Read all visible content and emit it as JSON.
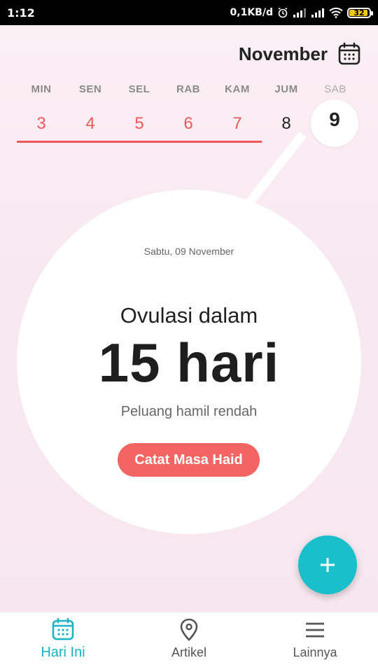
{
  "status_bar": {
    "time": "1:12",
    "network_speed": "0,1KB/d",
    "battery_level": "32",
    "icons": [
      "alarm-icon",
      "signal-icon",
      "signal-icon",
      "wifi-icon",
      "battery-icon"
    ]
  },
  "header": {
    "month": "November",
    "calendar_icon": "calendar-icon"
  },
  "week": {
    "days": [
      {
        "dow": "MIN",
        "num": "3",
        "state": "period"
      },
      {
        "dow": "SEN",
        "num": "4",
        "state": "period"
      },
      {
        "dow": "SEL",
        "num": "5",
        "state": "period"
      },
      {
        "dow": "RAB",
        "num": "6",
        "state": "period"
      },
      {
        "dow": "KAM",
        "num": "7",
        "state": "period"
      },
      {
        "dow": "JUM",
        "num": "8",
        "state": "normal"
      },
      {
        "dow": "SAB",
        "num": "9",
        "state": "selected"
      }
    ]
  },
  "summary": {
    "date": "Sabtu, 09 November",
    "ovulation_label": "Ovulasi dalam",
    "ovulation_days": "15 hari",
    "chance": "Peluang hamil rendah",
    "cta_label": "Catat Masa Haid"
  },
  "fab": {
    "icon": "plus-icon"
  },
  "nav": {
    "items": [
      {
        "label": "Hari Ini",
        "icon": "calendar-icon",
        "active": true
      },
      {
        "label": "Artikel",
        "icon": "location-pin-icon",
        "active": false
      },
      {
        "label": "Lainnya",
        "icon": "menu-icon",
        "active": false
      }
    ]
  },
  "colors": {
    "accent_red": "#ee5a5a",
    "cta_red": "#f26562",
    "teal": "#19c0cc",
    "nav_active": "#19b4c3"
  }
}
